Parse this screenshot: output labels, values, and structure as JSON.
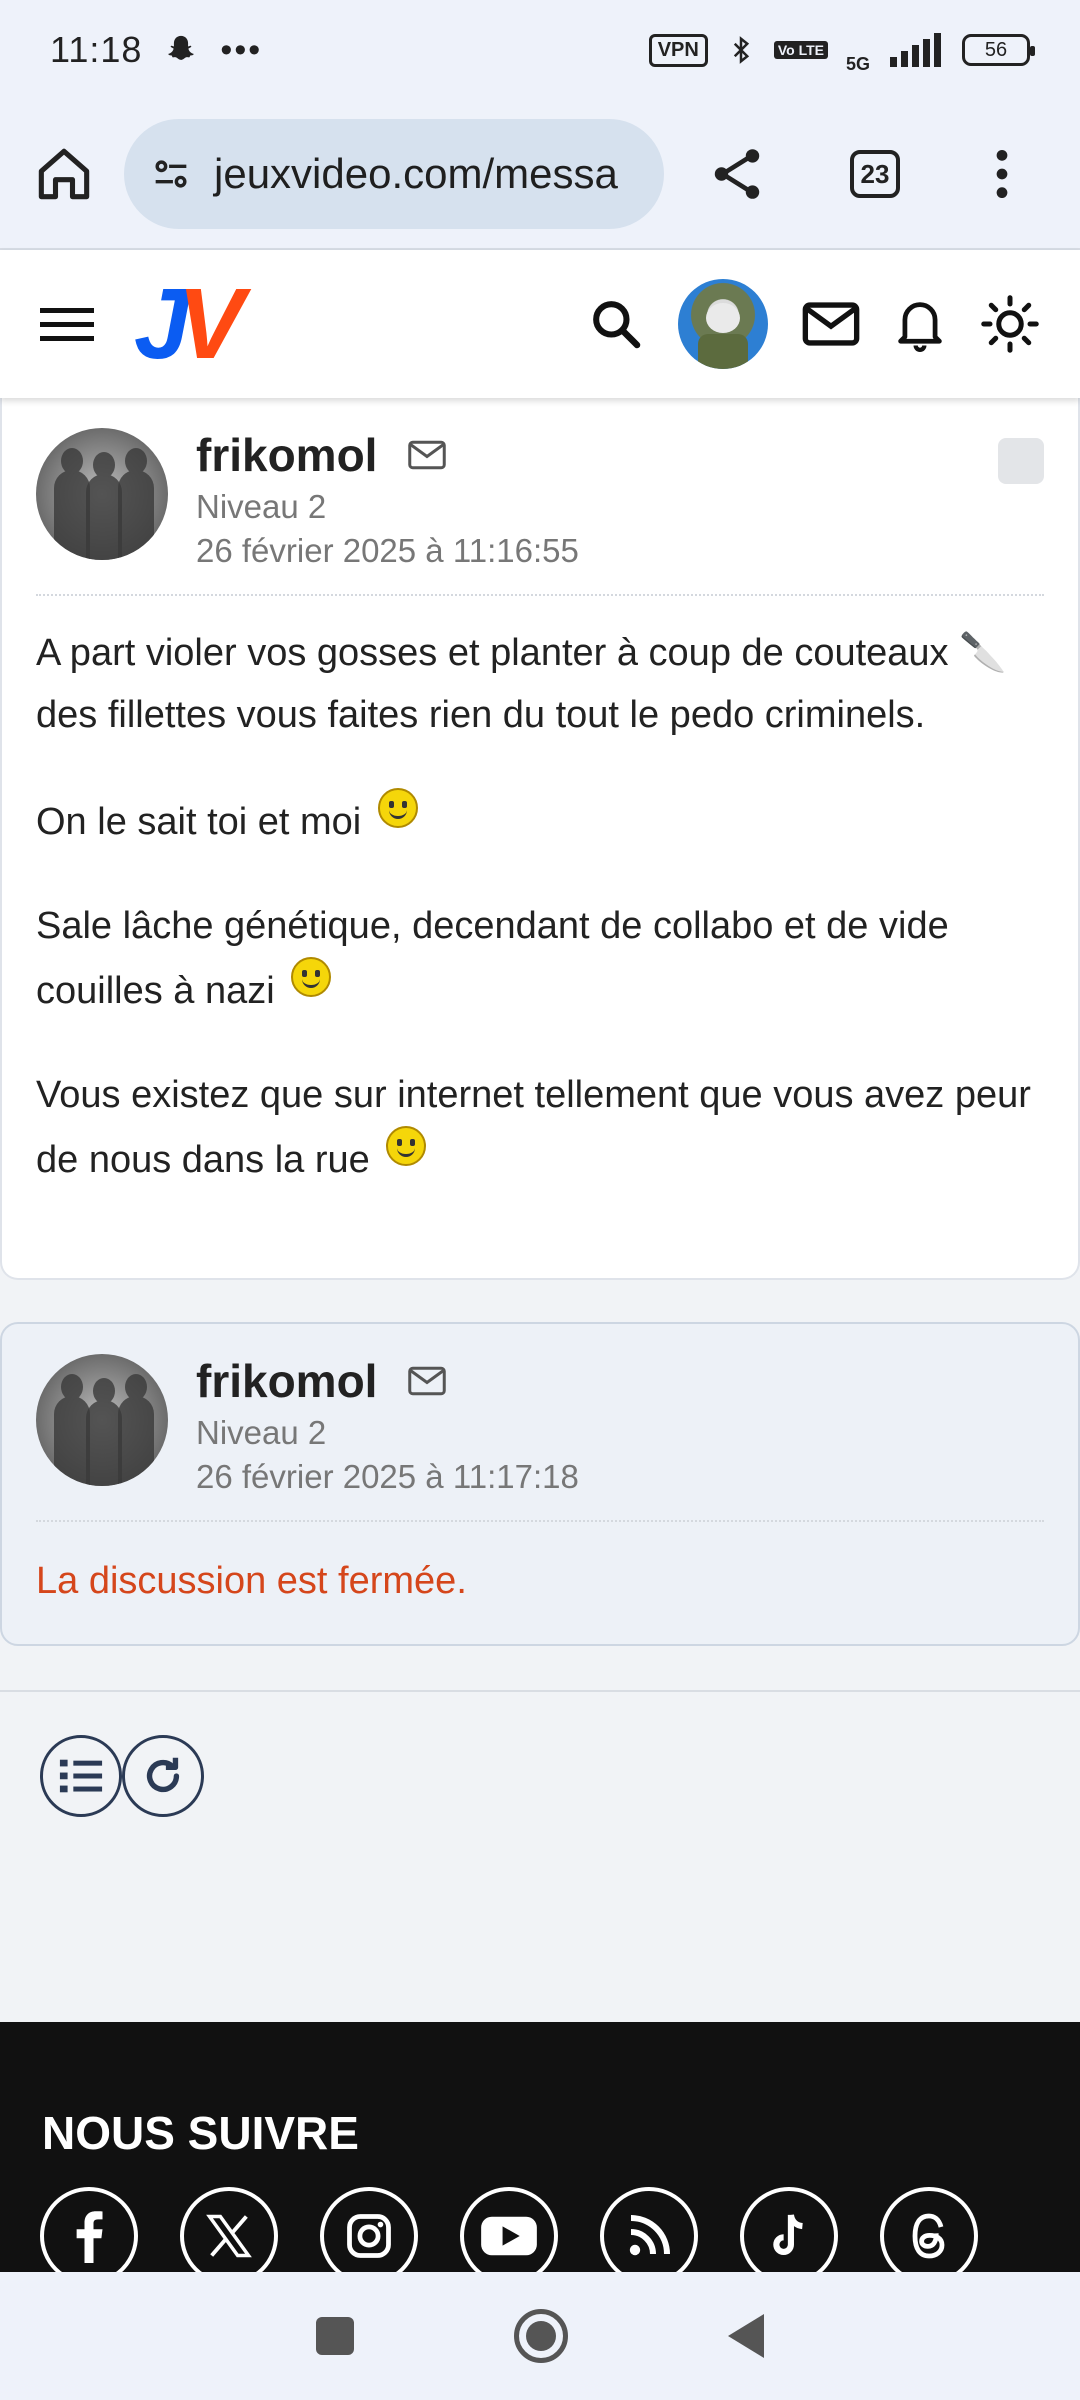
{
  "status_bar": {
    "time": "11:18",
    "vpn": "VPN",
    "volte": "Vo LTE",
    "network": "5G",
    "battery": "56"
  },
  "browser": {
    "url": "jeuxvideo.com/messa",
    "tab_count": "23"
  },
  "site": {
    "logo_j": "J",
    "logo_v": "V",
    "brand_colors": {
      "j": "#0b5cf2",
      "v": "#ff4a12"
    }
  },
  "posts": [
    {
      "author": "frikomol",
      "level": "Niveau 2",
      "date": "26 février 2025 à 11:16:55",
      "paragraphs": [
        "A part violer vos gosses et planter à coup de couteaux 🔪 des fillettes vous faites rien du tout le pedo criminels.",
        "On le sait toi et moi",
        "Sale lâche génétique, decendant de collabo et de vide couilles à nazi",
        "Vous existez que sur internet tellement que vous avez peur de nous dans la rue"
      ]
    },
    {
      "author": "frikomol",
      "level": "Niveau 2",
      "date": "26 février 2025 à 11:17:18",
      "closed_message": "La discussion est fermée."
    }
  ],
  "footer": {
    "title": "NOUS SUIVRE",
    "socials": [
      "facebook-icon",
      "x-icon",
      "instagram-icon",
      "youtube-icon",
      "rss-icon",
      "tiktok-icon",
      "threads-icon"
    ]
  },
  "colors": {
    "closed": "#d5461b",
    "footer_bg": "#111111"
  }
}
